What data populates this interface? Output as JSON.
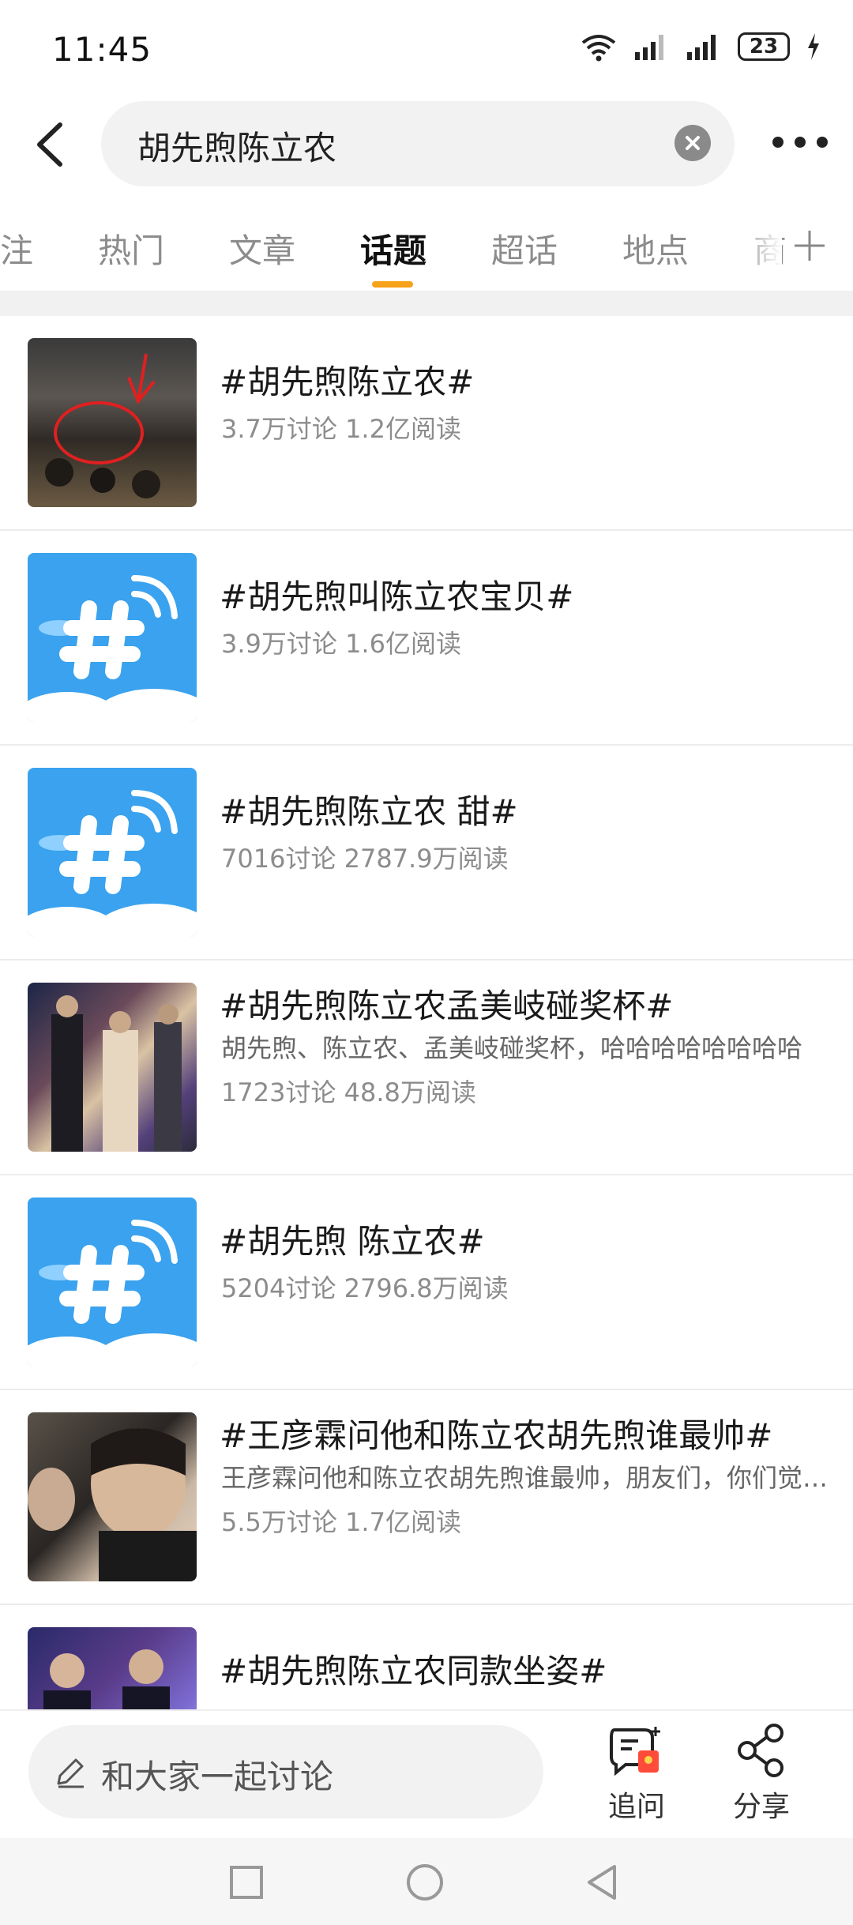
{
  "status_bar": {
    "time": "11:45",
    "battery": "23"
  },
  "search": {
    "query": "胡先煦陈立农"
  },
  "tabs": [
    {
      "label": "注"
    },
    {
      "label": "热门"
    },
    {
      "label": "文章"
    },
    {
      "label": "话题",
      "active": true
    },
    {
      "label": "超话"
    },
    {
      "label": "地点"
    },
    {
      "label": "商"
    }
  ],
  "topics": [
    {
      "title": "#胡先煦陈立农#",
      "meta": "3.7万讨论 1.2亿阅读",
      "thumb": "photo"
    },
    {
      "title": "#胡先煦叫陈立农宝贝#",
      "meta": "3.9万讨论 1.6亿阅读",
      "thumb": "hashtag-icon"
    },
    {
      "title": "#胡先煦陈立农 甜#",
      "meta": "7016讨论 2787.9万阅读",
      "thumb": "hashtag-icon"
    },
    {
      "title": "#胡先煦陈立农孟美岐碰奖杯#",
      "desc": "胡先煦、陈立农、孟美岐碰奖杯，哈哈哈哈哈哈哈哈",
      "meta": "1723讨论 48.8万阅读",
      "thumb": "photo"
    },
    {
      "title": "#胡先煦 陈立农#",
      "meta": "5204讨论 2796.8万阅读",
      "thumb": "hashtag-icon"
    },
    {
      "title": "#王彦霖问他和陈立农胡先煦谁最帅#",
      "desc": "王彦霖问他和陈立农胡先煦谁最帅，朋友们，你们觉得呢",
      "meta": "5.5万讨论 1.7亿阅读",
      "thumb": "photo"
    },
    {
      "title": "#胡先煦陈立农同款坐姿#",
      "thumb": "photo"
    }
  ],
  "bottom": {
    "discuss_placeholder": "和大家一起讨论",
    "ask_label": "追问",
    "share_label": "分享"
  },
  "colors": {
    "accent": "#f7a21b",
    "hashtag_bg": "#3aa2ee",
    "ask_badge": "#ff4b3a"
  }
}
